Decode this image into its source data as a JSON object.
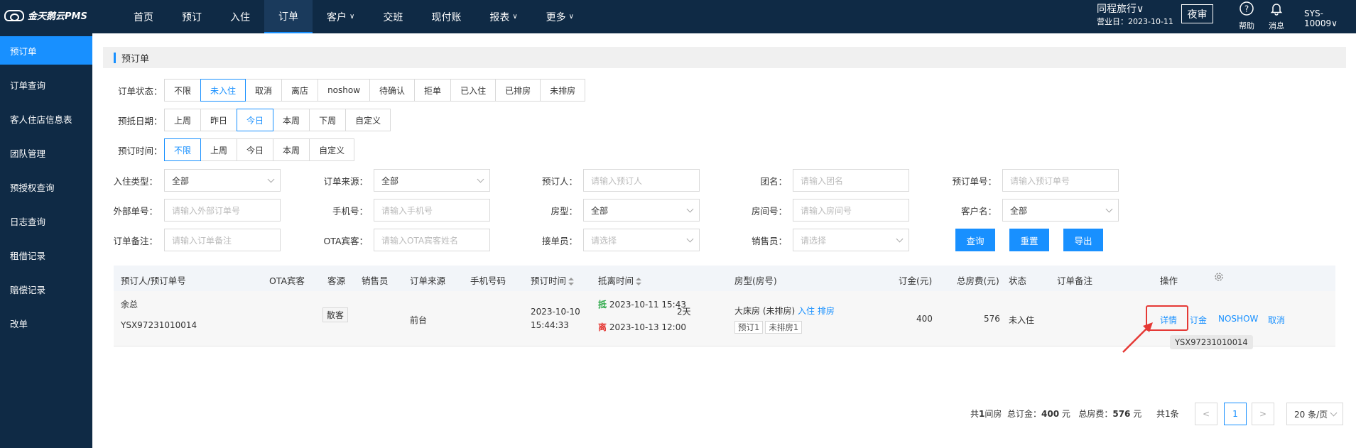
{
  "app": {
    "logo_text": "金天鹅云PMS"
  },
  "nav": [
    {
      "label": "首页",
      "caret": ""
    },
    {
      "label": "预订",
      "caret": ""
    },
    {
      "label": "入住",
      "caret": ""
    },
    {
      "label": "订单",
      "caret": "",
      "active": true
    },
    {
      "label": "客户",
      "caret": "∨"
    },
    {
      "label": "交班",
      "caret": ""
    },
    {
      "label": "现付账",
      "caret": ""
    },
    {
      "label": "报表",
      "caret": "∨"
    },
    {
      "label": "更多",
      "caret": "∨"
    }
  ],
  "header": {
    "hotel": "同程旅行∨",
    "business_date": "营业日：2023-10-11",
    "night_audit": "夜审",
    "help": "帮助",
    "messages": "消息",
    "user": "SYS-10009∨"
  },
  "sidebar": [
    {
      "label": "预订单",
      "active": true
    },
    {
      "label": "订单查询"
    },
    {
      "label": "客人住店信息表"
    },
    {
      "label": "团队管理"
    },
    {
      "label": "预授权查询"
    },
    {
      "label": "日志查询"
    },
    {
      "label": "租借记录"
    },
    {
      "label": "赔偿记录"
    },
    {
      "label": "改单"
    }
  ],
  "page": {
    "title": "预订单"
  },
  "filters": {
    "status": {
      "label": "订单状态：",
      "options": [
        "不限",
        "未入住",
        "取消",
        "离店",
        "noshow",
        "待确认",
        "拒单",
        "已入住",
        "已排房",
        "未排房"
      ],
      "selected": 1
    },
    "arrival": {
      "label": "预抵日期：",
      "options": [
        "上周",
        "昨日",
        "今日",
        "本周",
        "下周",
        "自定义"
      ],
      "selected": 2
    },
    "booking_time": {
      "label": "预订时间：",
      "options": [
        "不限",
        "上周",
        "今日",
        "本周",
        "自定义"
      ],
      "selected": 0
    }
  },
  "form": {
    "checkin_type": {
      "label": "入住类型：",
      "value": "全部"
    },
    "order_source": {
      "label": "订单来源：",
      "value": "全部"
    },
    "booker": {
      "label": "预订人：",
      "placeholder": "请输入预订人"
    },
    "group_name": {
      "label": "团名：",
      "placeholder": "请输入团名"
    },
    "booking_no": {
      "label": "预订单号：",
      "placeholder": "请输入预订单号"
    },
    "external_no": {
      "label": "外部单号：",
      "placeholder": "请输入外部订单号"
    },
    "phone": {
      "label": "手机号：",
      "placeholder": "请输入手机号"
    },
    "room_type": {
      "label": "房型：",
      "value": "全部"
    },
    "room_no": {
      "label": "房间号：",
      "placeholder": "请输入房间号"
    },
    "customer": {
      "label": "客户名：",
      "value": "全部"
    },
    "remark": {
      "label": "订单备注：",
      "placeholder": "请输入订单备注"
    },
    "ota_guest": {
      "label": "OTA宾客：",
      "placeholder": "请输入OTA宾客姓名"
    },
    "receiver": {
      "label": "接单员：",
      "placeholder": "请选择"
    },
    "sales": {
      "label": "销售员：",
      "placeholder": "请选择"
    },
    "query_btn": "查询",
    "reset_btn": "重置",
    "export_btn": "导出"
  },
  "table": {
    "headers": {
      "booker": "预订人/预订单号",
      "ota": "OTA宾客",
      "guest_source": "客源",
      "sales": "销售员",
      "source": "订单来源",
      "phone": "手机号码",
      "book_time": "预订时间",
      "stay_time": "抵离时间",
      "room": "房型(房号)",
      "deposit": "订金(元)",
      "total": "总房费(元)",
      "status": "状态",
      "remark": "订单备注",
      "ops": "操作"
    },
    "rows": [
      {
        "booker": "余总",
        "order_no": "YSX97231010014",
        "guest_source": "散客",
        "source": "前台",
        "book_date": "2023-10-10",
        "book_clock": "15:44:33",
        "arrive_mark": "抵",
        "arrive": "2023-10-11 15:43",
        "nights": "2天",
        "leave_mark": "离",
        "leave": "2023-10-13 12:00",
        "room": "大床房 (未排房)",
        "checkin_link": "入住",
        "assign_link": "排房",
        "tag1": "预订1",
        "tag2": "未排房1",
        "deposit": "400",
        "total": "576",
        "status": "未入住",
        "ops": {
          "detail": "详情",
          "deposit": "订金",
          "noshow": "NOSHOW",
          "cancel": "取消"
        }
      }
    ],
    "tooltip": "YSX97231010014"
  },
  "pagination": {
    "rooms": "1",
    "deposit": "400",
    "fee": "576",
    "total_records": "共1条",
    "page": "1",
    "page_size": "20 条/页"
  }
}
